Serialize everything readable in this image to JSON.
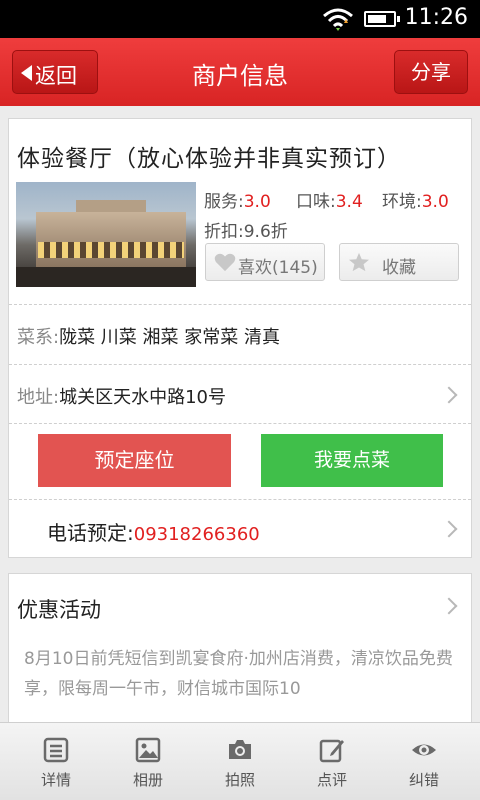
{
  "status_bar": {
    "time": "11:26"
  },
  "header": {
    "back_label": "返回",
    "title": "商户信息",
    "share_label": "分享"
  },
  "merchant": {
    "name": "体验餐厅（放心体验并非真实预订）",
    "ratings": [
      {
        "label": "服务:",
        "value": "3.0"
      },
      {
        "label": "口味:",
        "value": "3.4"
      },
      {
        "label": "环境:",
        "value": "3.0"
      }
    ],
    "discount": "折扣:9.6折",
    "like_label": "喜欢(145)",
    "favorite_label": "收藏",
    "cuisine_key": "菜系:",
    "cuisine_value": "陇菜 川菜 湘菜 家常菜 清真",
    "address_key": "地址:",
    "address_value": "城关区天水中路10号",
    "reserve_label": "预定座位",
    "order_label": "我要点菜",
    "phone_key": "电话预定:",
    "phone_value": "09318266360"
  },
  "promotion": {
    "title": "优惠活动",
    "text": "8月10日前凭短信到凯宴食府·加州店消费，清凉饮品免费享，限每周一午市，财信城市国际10"
  },
  "tabs": [
    {
      "label": "详情",
      "icon": "details-icon"
    },
    {
      "label": "相册",
      "icon": "album-icon"
    },
    {
      "label": "拍照",
      "icon": "camera-icon"
    },
    {
      "label": "点评",
      "icon": "review-icon"
    },
    {
      "label": "纠错",
      "icon": "correction-icon"
    }
  ],
  "colors": {
    "header_red": "#e33030",
    "reserve_red": "#e25451",
    "order_green": "#40bf4a",
    "value_red": "#e12020"
  }
}
